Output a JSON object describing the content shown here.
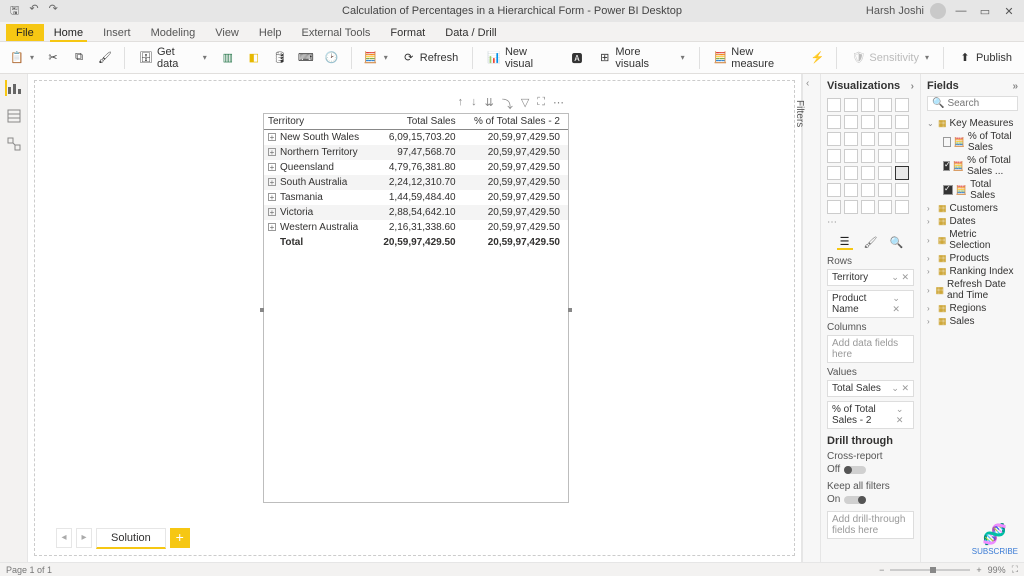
{
  "app": {
    "title": "Calculation of Percentages in a Hierarchical Form - Power BI Desktop",
    "user": "Harsh Joshi"
  },
  "menu_tabs": {
    "file": "File",
    "home": "Home",
    "insert": "Insert",
    "modeling": "Modeling",
    "view": "View",
    "help": "Help",
    "external": "External Tools",
    "format": "Format",
    "data_drill": "Data / Drill"
  },
  "ribbon": {
    "get_data": "Get data",
    "refresh": "Refresh",
    "new_visual": "New visual",
    "more_visuals": "More visuals",
    "new_measure": "New measure",
    "sensitivity": "Sensitivity",
    "publish": "Publish"
  },
  "filters_label": "Filters",
  "viz": {
    "title": "Visualizations",
    "rows": "Rows",
    "columns": "Columns",
    "values": "Values",
    "rows_fields": [
      "Territory",
      "Product Name"
    ],
    "columns_placeholder": "Add data fields here",
    "values_fields": [
      "Total Sales",
      "% of Total Sales - 2"
    ],
    "drill_through": "Drill through",
    "cross_report": "Cross-report",
    "off": "Off",
    "keep_filters": "Keep all filters",
    "on": "On",
    "drill_placeholder": "Add drill-through fields here"
  },
  "fields": {
    "title": "Fields",
    "search_placeholder": "Search",
    "tables": [
      {
        "name": "Key Measures",
        "expanded": true,
        "measures": [
          {
            "name": "% of Total Sales",
            "checked": false
          },
          {
            "name": "% of Total Sales ...",
            "checked": true
          },
          {
            "name": "Total Sales",
            "checked": true
          }
        ]
      },
      {
        "name": "Customers"
      },
      {
        "name": "Dates"
      },
      {
        "name": "Metric Selection"
      },
      {
        "name": "Products"
      },
      {
        "name": "Ranking Index"
      },
      {
        "name": "Refresh Date and Time"
      },
      {
        "name": "Regions"
      },
      {
        "name": "Sales"
      }
    ]
  },
  "matrix": {
    "headers": [
      "Territory",
      "Total Sales",
      "% of Total Sales - 2"
    ],
    "rows": [
      {
        "territory": "New South Wales",
        "total_sales": "6,09,15,703.20",
        "pct": "20,59,97,429.50"
      },
      {
        "territory": "Northern Territory",
        "total_sales": "97,47,568.70",
        "pct": "20,59,97,429.50"
      },
      {
        "territory": "Queensland",
        "total_sales": "4,79,76,381.80",
        "pct": "20,59,97,429.50"
      },
      {
        "territory": "South Australia",
        "total_sales": "2,24,12,310.70",
        "pct": "20,59,97,429.50"
      },
      {
        "territory": "Tasmania",
        "total_sales": "1,44,59,484.40",
        "pct": "20,59,97,429.50"
      },
      {
        "territory": "Victoria",
        "total_sales": "2,88,54,642.10",
        "pct": "20,59,97,429.50"
      },
      {
        "territory": "Western Australia",
        "total_sales": "2,16,31,338.60",
        "pct": "20,59,97,429.50"
      }
    ],
    "total_label": "Total",
    "total_sales": "20,59,97,429.50",
    "total_pct": "20,59,97,429.50"
  },
  "page_tabs": {
    "solution": "Solution"
  },
  "status": {
    "page_info": "Page 1 of 1",
    "zoom": "99%"
  },
  "subscribe": "SUBSCRIBE"
}
